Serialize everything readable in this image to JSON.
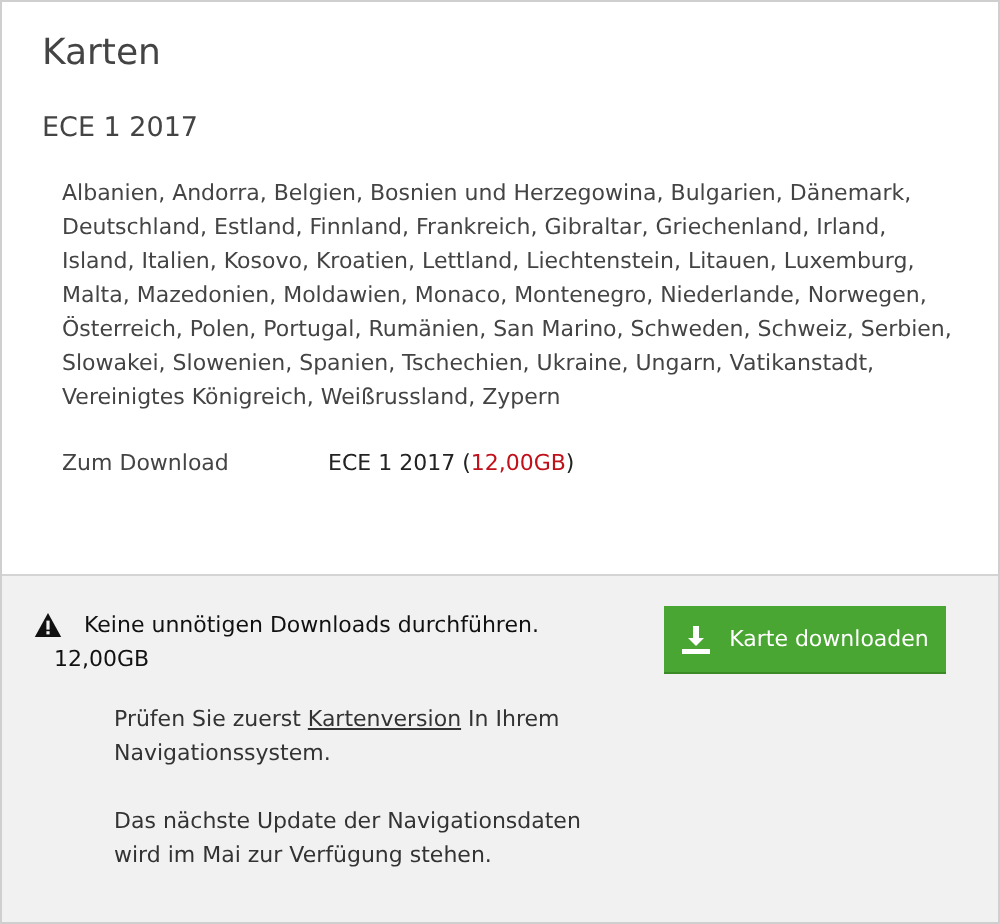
{
  "title": "Karten",
  "version": "ECE 1 2017",
  "countries": "Albanien, Andorra, Belgien, Bosnien und Herzegowina, Bulgarien, Dänemark, Deutschland, Estland, Finnland, Frankreich, Gibraltar, Griechenland, Irland, Island, Italien, Kosovo, Kroatien, Lettland, Liechtenstein, Litauen, Luxemburg, Malta, Mazedonien, Moldawien, Monaco, Montenegro, Niederlande, Norwegen, Österreich, Polen, Portugal, Rumänien, San Marino, Schweden, Schweiz, Serbien, Slowakei, Slowenien, Spanien, Tschechien, Ukraine, Ungarn, Vatikanstadt, Vereinigtes Königreich, Weißrussland, Zypern",
  "download": {
    "label": "Zum Download",
    "value_start": "ECE 1 2017 (",
    "size": "12,00GB",
    "value_end": ")"
  },
  "warning": {
    "text": "Keine unnötigen Downloads durchführen.",
    "size": "12,00GB"
  },
  "button": "Karte downloaden",
  "check": {
    "before": "Prüfen Sie zuerst ",
    "link": "Kartenversion",
    "after": " In Ihrem Navigationssystem."
  },
  "note": "Das nächste Update der Navigationsdaten wird im Mai zur Verfügung stehen."
}
